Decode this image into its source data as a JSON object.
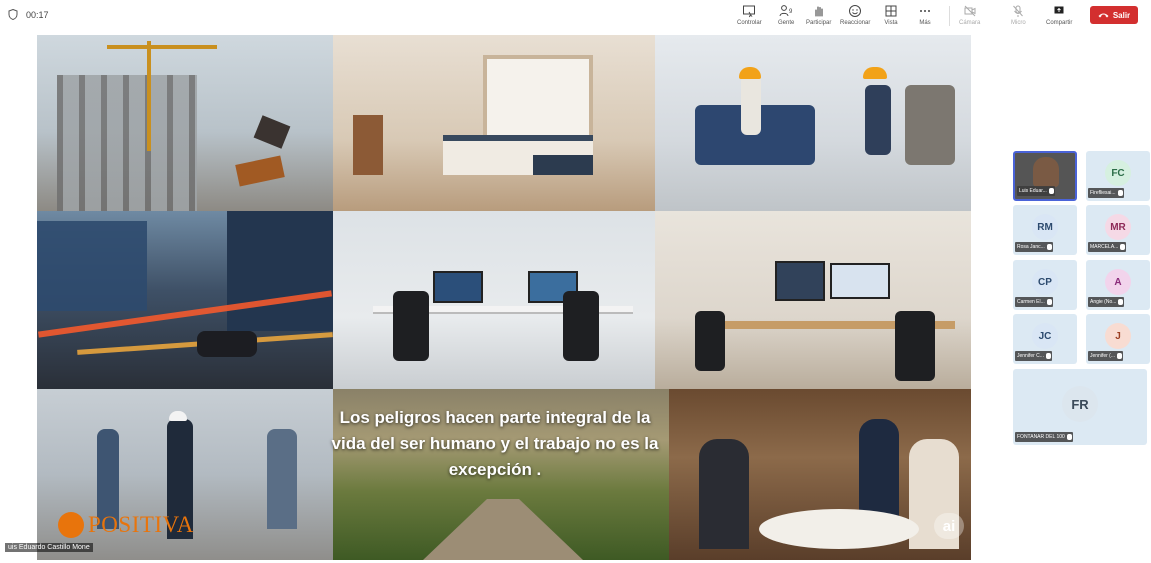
{
  "meeting": {
    "elapsed_time": "00:17"
  },
  "toolbar": {
    "items": [
      {
        "label": "Controlar",
        "icon": "remote-control-icon"
      },
      {
        "label": "Gente",
        "icon": "people-icon",
        "count": "9"
      },
      {
        "label": "Participar",
        "icon": "raise-hand-icon"
      },
      {
        "label": "Reaccionar",
        "icon": "emoji-icon"
      },
      {
        "label": "Vista",
        "icon": "grid-view-icon"
      },
      {
        "label": "Más",
        "icon": "more-icon"
      },
      {
        "label": "Cámara",
        "icon": "camera-off-icon"
      },
      {
        "label": "Micro",
        "icon": "mic-off-icon"
      },
      {
        "label": "Compartir",
        "icon": "share-screen-icon"
      }
    ],
    "leave_label": "Salir",
    "leave_color": "#d32f2f"
  },
  "shared_content": {
    "quote": "Los peligros hacen parte integral de la vida del ser humano y el trabajo no es la excepción .",
    "logo_text": "POSITIVA",
    "ai_badge": "ai",
    "presenter_name": "uis Eduardo Castillo Mone"
  },
  "participants": [
    {
      "initials": "",
      "name": "Luis Eduar...",
      "color": "#555555",
      "active": true
    },
    {
      "initials": "FC",
      "name": "Firefliesai...",
      "color": "#d6f0e0"
    },
    {
      "initials": "RM",
      "name": "Rosa Janc...",
      "color": "#d9e6f5"
    },
    {
      "initials": "MR",
      "name": "MARCELA...",
      "color": "#f5d9e6"
    },
    {
      "initials": "CP",
      "name": "Carmen El...",
      "color": "#d9e6f5"
    },
    {
      "initials": "A",
      "name": "Angie (No...",
      "color": "#f2d4ec"
    },
    {
      "initials": "JC",
      "name": "Jennifer C...",
      "color": "#d9e6f5"
    },
    {
      "initials": "J",
      "name": "Jennifer (...",
      "color": "#f8dcd2"
    },
    {
      "initials": "FR",
      "name": "FONTANAR DEL 100",
      "color": "#dce6ee"
    }
  ]
}
